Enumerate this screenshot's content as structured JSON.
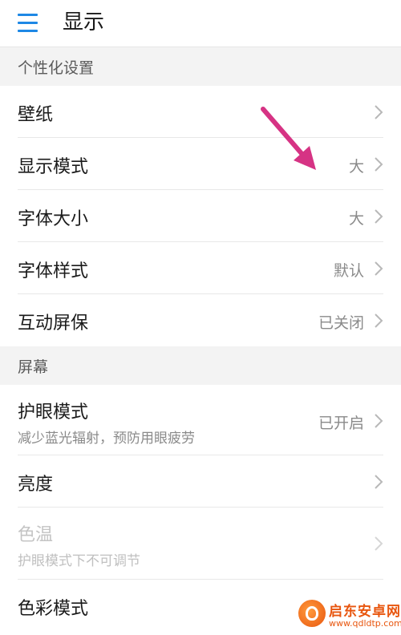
{
  "header": {
    "title": "显示"
  },
  "sections": {
    "personalize": "个性化设置",
    "screen": "屏幕"
  },
  "rows": {
    "wallpaper": {
      "title": "壁纸"
    },
    "display_mode": {
      "title": "显示模式",
      "value": "大"
    },
    "font_size": {
      "title": "字体大小",
      "value": "大"
    },
    "font_style": {
      "title": "字体样式",
      "value": "默认"
    },
    "screensaver": {
      "title": "互动屏保",
      "value": "已关闭"
    },
    "eye_comfort": {
      "title": "护眼模式",
      "subtitle": "减少蓝光辐射，预防用眼疲劳",
      "value": "已开启"
    },
    "brightness": {
      "title": "亮度"
    },
    "color_temp": {
      "title": "色温",
      "subtitle": "护眼模式下不可调节"
    },
    "color_mode": {
      "title": "色彩模式"
    }
  },
  "watermark": {
    "name": "启东安卓网",
    "url": "www.qdldtp.com"
  },
  "colors": {
    "accent": "#1e88e5",
    "annotation_arrow": "#d63384",
    "watermark": "#e8560f"
  },
  "icons": {
    "menu": "hamburger-menu-icon",
    "chevron": "chevron-right-icon",
    "annotation": "pink-arrow-annotation"
  }
}
